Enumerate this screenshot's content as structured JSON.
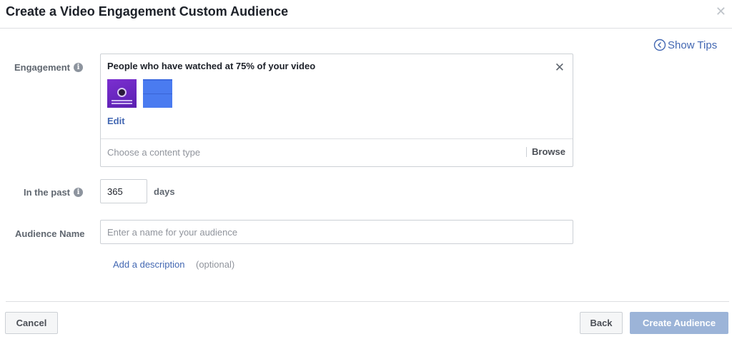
{
  "dialog": {
    "title": "Create a Video Engagement Custom Audience",
    "close_icon": "close-icon",
    "show_tips": "Show Tips"
  },
  "form": {
    "engagement": {
      "label": "Engagement",
      "selected_title": "People who have watched at 75% of your video",
      "edit_label": "Edit",
      "content_type_placeholder": "Choose a content type",
      "browse_label": "Browse"
    },
    "past": {
      "label": "In the past",
      "value": "365",
      "unit": "days"
    },
    "audience_name": {
      "label": "Audience Name",
      "placeholder": "Enter a name for your audience"
    },
    "description": {
      "link": "Add a description",
      "optional": "(optional)"
    }
  },
  "footer": {
    "cancel": "Cancel",
    "back": "Back",
    "create": "Create Audience"
  },
  "colors": {
    "link": "#4267b2",
    "create_button_disabled": "#9cb4d8"
  }
}
